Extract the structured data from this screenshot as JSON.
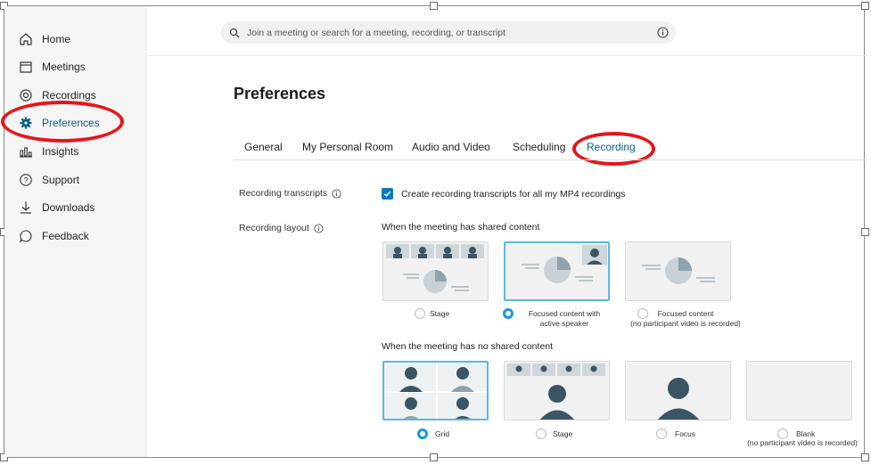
{
  "search": {
    "placeholder": "Join a meeting or search for a meeting, recording, or transcript"
  },
  "sidebar": {
    "items": [
      {
        "label": "Home",
        "icon": "home-icon"
      },
      {
        "label": "Meetings",
        "icon": "calendar-icon"
      },
      {
        "label": "Recordings",
        "icon": "record-icon"
      },
      {
        "label": "Preferences",
        "icon": "gear-icon",
        "active": true
      },
      {
        "label": "Insights",
        "icon": "bar-chart-icon"
      },
      {
        "label": "Support",
        "icon": "help-icon"
      },
      {
        "label": "Downloads",
        "icon": "download-icon"
      },
      {
        "label": "Feedback",
        "icon": "chat-icon"
      }
    ]
  },
  "page": {
    "title": "Preferences"
  },
  "tabs": [
    "General",
    "My Personal Room",
    "Audio and Video",
    "Scheduling",
    "Recording"
  ],
  "active_tab": "Recording",
  "recording_transcripts": {
    "label": "Recording transcripts",
    "checkbox_label": "Create recording transcripts for all my MP4 recordings",
    "checked": true
  },
  "recording_layout": {
    "label": "Recording layout",
    "shared": {
      "heading": "When the meeting has shared content",
      "options": [
        {
          "label": "Stage",
          "selected": false
        },
        {
          "label": "Focused content with",
          "label2": "active speaker",
          "selected": true
        },
        {
          "label": "Focused content",
          "label2": "(no participant video is recorded)",
          "selected": false
        }
      ]
    },
    "no_shared": {
      "heading": "When the meeting has no shared content",
      "options": [
        {
          "label": "Grid",
          "selected": true
        },
        {
          "label": "Stage",
          "selected": false
        },
        {
          "label": "Focus",
          "selected": false
        },
        {
          "label": "Blank",
          "label2": "(no participant video is recorded)",
          "selected": false
        }
      ]
    }
  },
  "colors": {
    "accent": "#0a7ac2",
    "active_text": "#0b5e88",
    "highlight_ellipse": "#e8141b",
    "selected_border": "#5ab8e8"
  }
}
